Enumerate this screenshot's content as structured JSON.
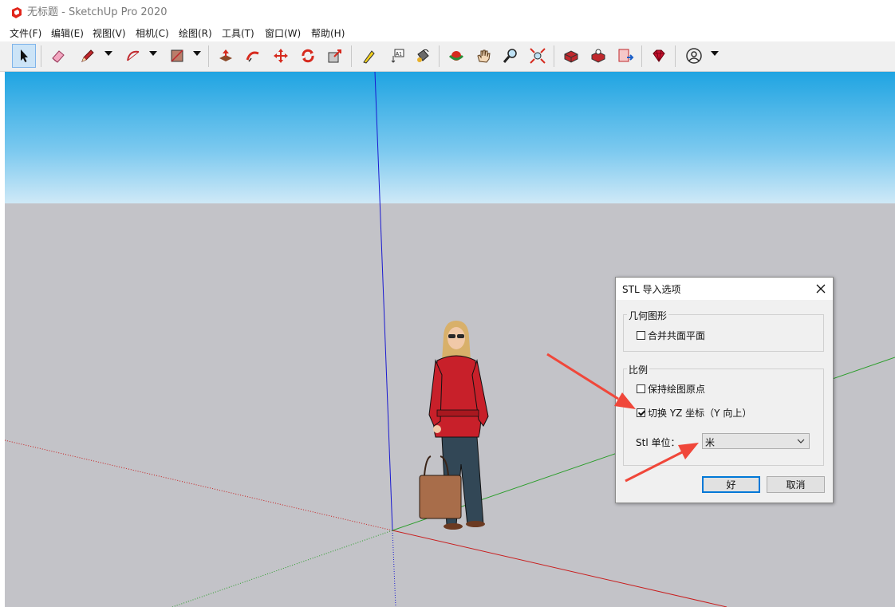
{
  "window": {
    "title": "无标题 - SketchUp Pro 2020"
  },
  "menu": [
    "文件(F)",
    "编辑(E)",
    "视图(V)",
    "相机(C)",
    "绘图(R)",
    "工具(T)",
    "窗口(W)",
    "帮助(H)"
  ],
  "toolbar": {
    "icons": [
      "select-icon",
      "eraser-icon",
      "pencil-icon",
      "arc-icon",
      "rectangle-icon",
      "push-pull-icon",
      "follow-me-icon",
      "move-icon",
      "rotate-icon",
      "scale-icon",
      "tape-measure-icon",
      "text-icon",
      "paint-bucket-icon",
      "orbit-icon",
      "pan-icon",
      "zoom-icon",
      "zoom-extents-icon",
      "3d-warehouse-icon",
      "extension-warehouse-icon",
      "layout-icon",
      "ruby-icon",
      "account-icon"
    ],
    "text_tool_label": "A1"
  },
  "dialog": {
    "title": "STL 导入选项",
    "geometry_group": "几何图形",
    "merge_coplanar": {
      "label": "合并共面平面",
      "checked": false
    },
    "scale_group": "比例",
    "preserve_origin": {
      "label": "保持绘图原点",
      "checked": false
    },
    "swap_yz": {
      "label": "切换 YZ 坐标（Y 向上）",
      "checked": true
    },
    "unit_label": "Stl 单位：",
    "unit_value": "米",
    "ok_label": "好",
    "cancel_label": "取消"
  },
  "colors": {
    "arrow_annotation": "#f0473a",
    "axis_red": "#c81e1e",
    "axis_green": "#2a9d2a",
    "axis_blue": "#1a1ad0",
    "accent": "#0078d7"
  }
}
